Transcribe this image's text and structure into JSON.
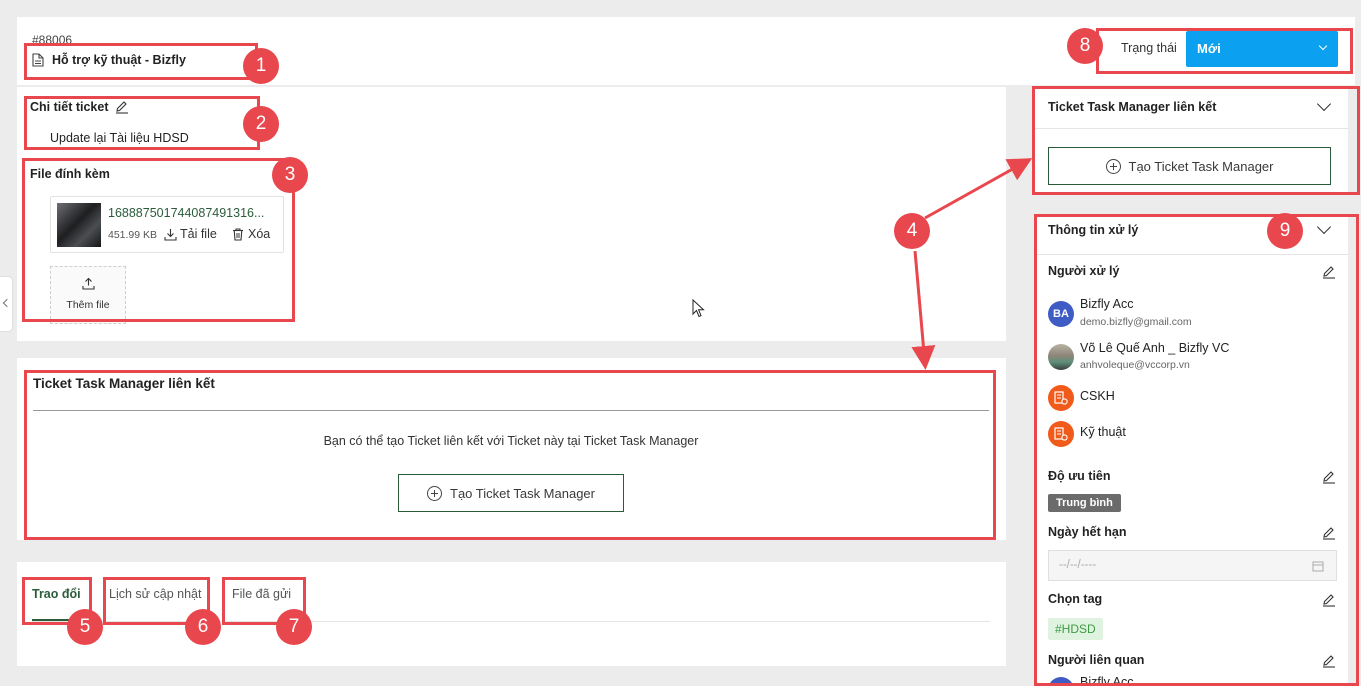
{
  "ticket": {
    "id": "#88006",
    "title": "Hỗ trợ kỹ thuật - Bizfly",
    "status_label": "Trạng thái",
    "status_value": "Mới"
  },
  "detail": {
    "heading": "Chi tiết ticket",
    "content": "Update lại Tài liệu HDSD"
  },
  "attachments": {
    "heading": "File đính kèm",
    "file_name": "1688875017440874913​16...",
    "file_size": "451.99 KB",
    "download_label": "Tải file",
    "delete_label": "Xóa",
    "add_label": "Thêm file"
  },
  "linked_main": {
    "heading": "Ticket Task Manager liên kết",
    "description": "Bạn có thể tạo Ticket liên kết với Ticket này tại Ticket Task Manager",
    "create_label": "Tạo Ticket Task Manager"
  },
  "tabs": [
    "Trao đổi",
    "Lịch sử cập nhật",
    "File đã gửi"
  ],
  "sidebar_linked": {
    "heading": "Ticket Task Manager liên kết",
    "create_label": "Tạo Ticket Task Manager"
  },
  "processing": {
    "heading": "Thông tin xử lý",
    "assignee_label": "Người xử lý",
    "assignees": [
      {
        "initials": "BA",
        "name": "Bizfly Acc",
        "email": "demo.bizfly@gmail.com"
      },
      {
        "initials": "",
        "name": "Võ Lê Quế Anh _ Bizfly VC",
        "email": "anhvoleque@vccorp.vn"
      },
      {
        "initials": "",
        "name": "CSKH",
        "email": ""
      },
      {
        "initials": "",
        "name": "Kỹ thuật",
        "email": ""
      }
    ],
    "priority_label": "Độ ưu tiên",
    "priority_value": "Trung bình",
    "due_label": "Ngày hết hạn",
    "due_placeholder": "--/--/----",
    "tag_label": "Chọn tag",
    "tag_value": "#HDSD",
    "related_label": "Người liên quan",
    "related_first": "Bizfly Acc"
  },
  "annotations": [
    "1",
    "2",
    "3",
    "4",
    "5",
    "6",
    "7",
    "8",
    "9"
  ],
  "colors": {
    "accent_blue": "#0ba0f0",
    "annotation_red": "#e8474d",
    "priority_gray": "#6b6b6b",
    "tag_green": "#dff3e0",
    "btn_border": "#2b5c3a"
  }
}
